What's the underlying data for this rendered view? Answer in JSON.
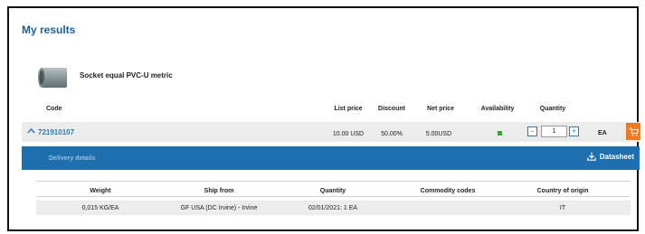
{
  "title": "My results",
  "product": {
    "name": "Socket equal PVC-U metric"
  },
  "columns": {
    "code": "Code",
    "list_price": "List price",
    "discount": "Discount",
    "net_price": "Net price",
    "availability": "Availability",
    "quantity": "Quantity"
  },
  "item": {
    "code": "721910107",
    "list_price": "10.00 USD",
    "discount": "50.00%",
    "net_price": "5.00USD",
    "availability_color": "#3aa635",
    "quantity": "1",
    "minus": "-",
    "plus": "+",
    "unit": "EA",
    "cart_icon": "cart-icon"
  },
  "delivery": {
    "label": "Delivery details",
    "datasheet_label": "Datasheet",
    "columns": {
      "weight": "Weight",
      "ship_from": "Ship from",
      "quantity": "Quantity",
      "commodity_codes": "Commodity codes",
      "country_of_origin": "Country of origin"
    },
    "row": {
      "weight": "0,015 KG/EA",
      "ship_from": "GF USA (DC Irvine) - Irvine",
      "quantity": "02/01/2021: 1 EA",
      "commodity_codes": "",
      "country_of_origin": "IT"
    }
  },
  "colors": {
    "accent": "#2b79b8",
    "delivery_bar": "#1f6fae",
    "cart": "#f07a1d"
  }
}
